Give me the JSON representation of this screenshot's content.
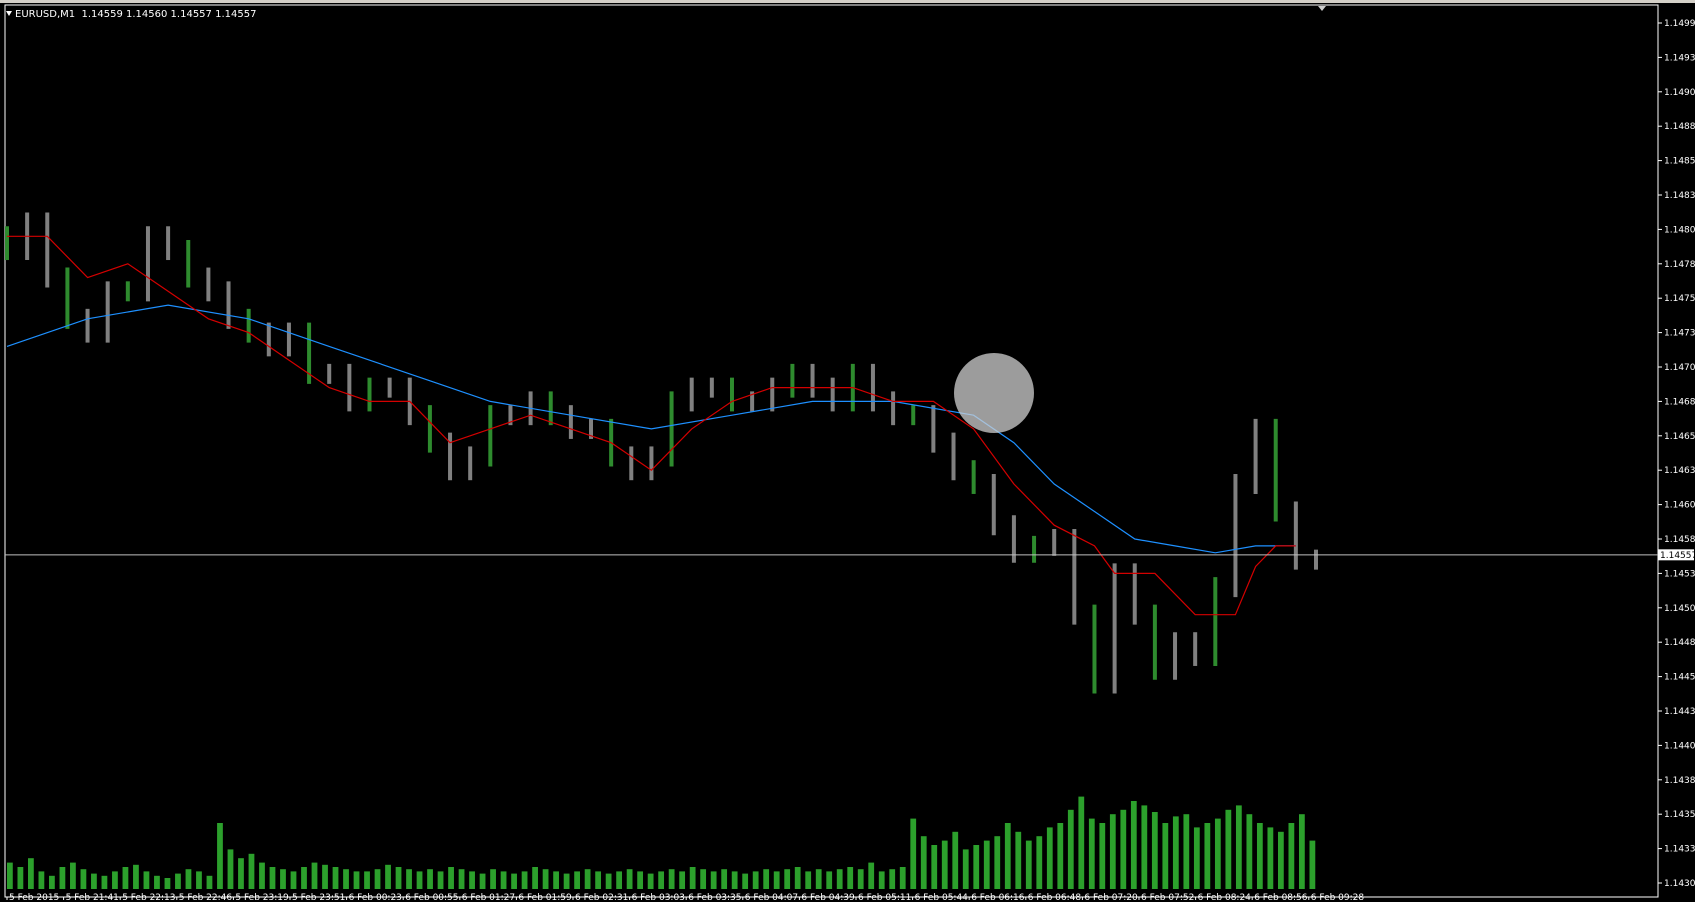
{
  "header": {
    "symbol": "EURUSD,M1",
    "ohlc": "1.14559 1.14560 1.14557 1.14557"
  },
  "colors": {
    "background": "#000000",
    "axis": "#ffffff",
    "candles": "#808080",
    "candles_up": "#2e8b2e",
    "ma_fast": "#d40000",
    "ma_slow": "#1e90ff",
    "volume": "#2ca02c",
    "price_line": "#c0c0c0"
  },
  "chart_data": {
    "type": "line",
    "title": "",
    "current_price": "1.14557",
    "y_ticks": [
      "1.14995",
      "1.14930",
      "1.14905",
      "1.14880",
      "1.14855",
      "1.14830",
      "1.14805",
      "1.14780",
      "1.14755",
      "1.14730",
      "1.14705",
      "1.14680",
      "1.14655",
      "1.14630",
      "1.14605",
      "1.14580",
      "1.14530",
      "1.14505",
      "1.14480",
      "1.14455",
      "1.14430",
      "1.14405",
      "1.14380",
      "1.14355",
      "1.14330",
      "1.14305"
    ],
    "ylim": [
      1.14305,
      1.14995
    ],
    "x_ticks": [
      "5 Feb 2015",
      "5 Feb 21:41",
      "5 Feb 22:13",
      "5 Feb 22:46",
      "5 Feb 23:19",
      "5 Feb 23:51",
      "6 Feb 00:23",
      "6 Feb 00:55",
      "6 Feb 01:27",
      "6 Feb 01:59",
      "6 Feb 02:31",
      "6 Feb 03:03",
      "6 Feb 03:35",
      "6 Feb 04:07",
      "6 Feb 04:39",
      "6 Feb 05:11",
      "6 Feb 05:44",
      "6 Feb 06:16",
      "6 Feb 06:48",
      "6 Feb 07:20",
      "6 Feb 07:52",
      "6 Feb 08:24",
      "6 Feb 08:56",
      "6 Feb 09:28"
    ],
    "price_series": {
      "name": "",
      "points": [
        [
          0,
          1.148
        ],
        [
          2,
          1.1479
        ],
        [
          4,
          1.1481
        ],
        [
          6,
          1.1477
        ],
        [
          8,
          1.1474
        ],
        [
          10,
          1.1473
        ],
        [
          12,
          1.1476
        ],
        [
          14,
          1.1476
        ],
        [
          16,
          1.148
        ],
        [
          18,
          1.1479
        ],
        [
          20,
          1.1477
        ],
        [
          22,
          1.1476
        ],
        [
          24,
          1.1474
        ],
        [
          26,
          1.1473
        ],
        [
          28,
          1.1472
        ],
        [
          30,
          1.1473
        ],
        [
          32,
          1.147
        ],
        [
          34,
          1.147
        ],
        [
          36,
          1.1468
        ],
        [
          38,
          1.1469
        ],
        [
          40,
          1.1469
        ],
        [
          42,
          1.1467
        ],
        [
          44,
          1.1465
        ],
        [
          46,
          1.1463
        ],
        [
          48,
          1.1464
        ],
        [
          50,
          1.1467
        ],
        [
          52,
          1.1467
        ],
        [
          54,
          1.1468
        ],
        [
          56,
          1.1467
        ],
        [
          58,
          1.1466
        ],
        [
          60,
          1.1466
        ],
        [
          62,
          1.1464
        ],
        [
          64,
          1.1463
        ],
        [
          66,
          1.1464
        ],
        [
          68,
          1.1468
        ],
        [
          70,
          1.1469
        ],
        [
          72,
          1.1469
        ],
        [
          74,
          1.1468
        ],
        [
          76,
          1.1468
        ],
        [
          78,
          1.1469
        ],
        [
          80,
          1.147
        ],
        [
          82,
          1.1469
        ],
        [
          84,
          1.1468
        ],
        [
          86,
          1.147
        ],
        [
          88,
          1.1468
        ],
        [
          90,
          1.1467
        ],
        [
          92,
          1.1467
        ],
        [
          94,
          1.1465
        ],
        [
          96,
          1.1463
        ],
        [
          98,
          1.1462
        ],
        [
          100,
          1.1459
        ],
        [
          102,
          1.1456
        ],
        [
          104,
          1.1457
        ],
        [
          106,
          1.1458
        ],
        [
          108,
          1.145
        ],
        [
          110,
          1.1445
        ],
        [
          112,
          1.1453
        ],
        [
          114,
          1.145
        ],
        [
          116,
          1.1446
        ],
        [
          118,
          1.1448
        ],
        [
          120,
          1.1447
        ],
        [
          122,
          1.1452
        ],
        [
          124,
          1.1462
        ],
        [
          126,
          1.1466
        ],
        [
          128,
          1.146
        ],
        [
          130,
          1.1455
        ]
      ]
    },
    "ma_fast": {
      "name": "",
      "points": [
        [
          0,
          1.148
        ],
        [
          4,
          1.148
        ],
        [
          8,
          1.1477
        ],
        [
          12,
          1.1478
        ],
        [
          16,
          1.1476
        ],
        [
          20,
          1.1474
        ],
        [
          24,
          1.1473
        ],
        [
          28,
          1.1471
        ],
        [
          32,
          1.1469
        ],
        [
          36,
          1.1468
        ],
        [
          40,
          1.1468
        ],
        [
          44,
          1.1465
        ],
        [
          48,
          1.1466
        ],
        [
          52,
          1.1467
        ],
        [
          56,
          1.1466
        ],
        [
          60,
          1.1465
        ],
        [
          64,
          1.1463
        ],
        [
          68,
          1.1466
        ],
        [
          72,
          1.1468
        ],
        [
          76,
          1.1469
        ],
        [
          80,
          1.1469
        ],
        [
          84,
          1.1469
        ],
        [
          88,
          1.1468
        ],
        [
          92,
          1.1468
        ],
        [
          96,
          1.1466
        ],
        [
          100,
          1.1462
        ],
        [
          104,
          1.1459
        ],
        [
          108,
          1.1457
        ],
        [
          110,
          1.1453
        ],
        [
          114,
          1.1453
        ],
        [
          118,
          1.145
        ],
        [
          122,
          1.145
        ],
        [
          124,
          1.1454
        ],
        [
          126,
          1.1457
        ],
        [
          128,
          1.1457
        ]
      ]
    },
    "ma_slow": {
      "name": "",
      "points": [
        [
          0,
          1.1472
        ],
        [
          8,
          1.1474
        ],
        [
          16,
          1.1475
        ],
        [
          24,
          1.1474
        ],
        [
          32,
          1.1472
        ],
        [
          40,
          1.147
        ],
        [
          48,
          1.1468
        ],
        [
          56,
          1.1467
        ],
        [
          64,
          1.1466
        ],
        [
          72,
          1.1467
        ],
        [
          80,
          1.1468
        ],
        [
          88,
          1.1468
        ],
        [
          96,
          1.1467
        ],
        [
          100,
          1.1465
        ],
        [
          104,
          1.1462
        ],
        [
          108,
          1.146
        ],
        [
          112,
          1.1458
        ],
        [
          116,
          1.1457
        ],
        [
          120,
          1.1456
        ],
        [
          124,
          1.1457
        ],
        [
          128,
          1.1457
        ]
      ]
    },
    "volume": {
      "name": "",
      "values": [
        12,
        10,
        14,
        8,
        6,
        10,
        12,
        9,
        7,
        6,
        8,
        10,
        11,
        8,
        6,
        5,
        7,
        9,
        8,
        6,
        30,
        18,
        14,
        16,
        12,
        10,
        9,
        8,
        10,
        12,
        11,
        10,
        9,
        8,
        8,
        9,
        11,
        10,
        9,
        8,
        9,
        8,
        10,
        9,
        8,
        7,
        9,
        8,
        7,
        8,
        10,
        9,
        8,
        7,
        8,
        9,
        8,
        7,
        8,
        9,
        8,
        7,
        8,
        9,
        8,
        10,
        9,
        8,
        9,
        8,
        7,
        8,
        9,
        8,
        9,
        10,
        8,
        9,
        8,
        9,
        10,
        9,
        12,
        8,
        9,
        10,
        32,
        24,
        20,
        22,
        26,
        18,
        20,
        22,
        24,
        30,
        26,
        22,
        24,
        28,
        30,
        36,
        42,
        32,
        30,
        34,
        36,
        40,
        38,
        35,
        30,
        33,
        34,
        28,
        30,
        32,
        36,
        38,
        34,
        30,
        28,
        26,
        30,
        34,
        22
      ]
    }
  }
}
